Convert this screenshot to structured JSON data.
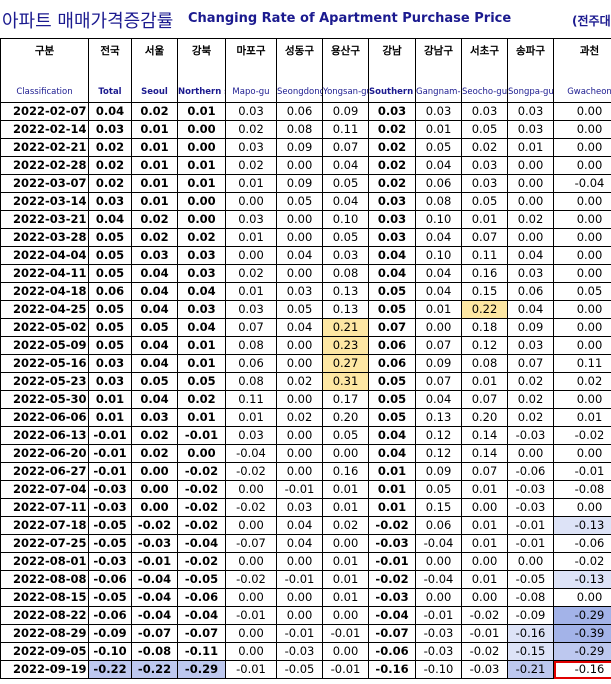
{
  "title": {
    "korean": "아파트 매매가격증감률",
    "english": "Changing Rate of Apartment Purchase Price",
    "unit": "(전주대비"
  },
  "columns": [
    {
      "kor": "구분",
      "eng": "Classification"
    },
    {
      "kor": "전국",
      "eng": "Total"
    },
    {
      "kor": "서울",
      "eng": "Seoul"
    },
    {
      "kor": "강북",
      "eng": "Northern seoul"
    },
    {
      "kor": "마포구",
      "eng": "Mapo-gu"
    },
    {
      "kor": "성동구",
      "eng": "Seongdong-gu"
    },
    {
      "kor": "용산구",
      "eng": "Yongsan-gu"
    },
    {
      "kor": "강남",
      "eng": "Southern Seoul"
    },
    {
      "kor": "강남구",
      "eng": "Gangnam-gu"
    },
    {
      "kor": "서초구",
      "eng": "Seocho-gu"
    },
    {
      "kor": "송파구",
      "eng": "Songpa-gu"
    },
    {
      "kor": "과천",
      "eng": "Gwacheon"
    }
  ],
  "rows": [
    {
      "date": "2022-02-07",
      "values": [
        "0.04",
        "0.02",
        "0.01",
        "0.03",
        "0.06",
        "0.09",
        "0.03",
        "0.03",
        "0.03",
        "0.03",
        "0.00"
      ]
    },
    {
      "date": "2022-02-14",
      "values": [
        "0.03",
        "0.01",
        "0.00",
        "0.02",
        "0.08",
        "0.11",
        "0.02",
        "0.01",
        "0.05",
        "0.03",
        "0.00"
      ]
    },
    {
      "date": "2022-02-21",
      "values": [
        "0.02",
        "0.01",
        "0.00",
        "0.03",
        "0.09",
        "0.07",
        "0.02",
        "0.05",
        "0.02",
        "0.01",
        "0.00"
      ]
    },
    {
      "date": "2022-02-28",
      "values": [
        "0.02",
        "0.01",
        "0.01",
        "0.02",
        "0.00",
        "0.04",
        "0.02",
        "0.04",
        "0.03",
        "0.00",
        "0.00"
      ]
    },
    {
      "date": "2022-03-07",
      "values": [
        "0.02",
        "0.01",
        "0.01",
        "0.01",
        "0.09",
        "0.05",
        "0.02",
        "0.06",
        "0.03",
        "0.00",
        "-0.04"
      ]
    },
    {
      "date": "2022-03-14",
      "values": [
        "0.03",
        "0.01",
        "0.00",
        "0.00",
        "0.05",
        "0.04",
        "0.03",
        "0.08",
        "0.05",
        "0.00",
        "0.00"
      ]
    },
    {
      "date": "2022-03-21",
      "values": [
        "0.04",
        "0.02",
        "0.00",
        "0.03",
        "0.00",
        "0.10",
        "0.03",
        "0.10",
        "0.01",
        "0.02",
        "0.00"
      ]
    },
    {
      "date": "2022-03-28",
      "values": [
        "0.05",
        "0.02",
        "0.02",
        "0.01",
        "0.00",
        "0.05",
        "0.03",
        "0.04",
        "0.07",
        "0.00",
        "0.00"
      ]
    },
    {
      "date": "2022-04-04",
      "values": [
        "0.05",
        "0.03",
        "0.03",
        "0.00",
        "0.04",
        "0.03",
        "0.04",
        "0.10",
        "0.11",
        "0.04",
        "0.00"
      ]
    },
    {
      "date": "2022-04-11",
      "values": [
        "0.05",
        "0.04",
        "0.03",
        "0.02",
        "0.00",
        "0.08",
        "0.04",
        "0.04",
        "0.16",
        "0.03",
        "0.00"
      ]
    },
    {
      "date": "2022-04-18",
      "values": [
        "0.06",
        "0.04",
        "0.04",
        "0.01",
        "0.03",
        "0.13",
        "0.05",
        "0.04",
        "0.15",
        "0.06",
        "0.05"
      ]
    },
    {
      "date": "2022-04-25",
      "values": [
        "0.05",
        "0.04",
        "0.03",
        "0.03",
        "0.05",
        "0.13",
        "0.05",
        "0.01",
        "0.22",
        "0.04",
        "0.00"
      ]
    },
    {
      "date": "2022-05-02",
      "values": [
        "0.05",
        "0.05",
        "0.04",
        "0.07",
        "0.04",
        "0.21",
        "0.07",
        "0.00",
        "0.18",
        "0.09",
        "0.00"
      ]
    },
    {
      "date": "2022-05-09",
      "values": [
        "0.05",
        "0.04",
        "0.01",
        "0.08",
        "0.00",
        "0.23",
        "0.06",
        "0.07",
        "0.12",
        "0.03",
        "0.00"
      ]
    },
    {
      "date": "2022-05-16",
      "values": [
        "0.03",
        "0.04",
        "0.01",
        "0.06",
        "0.00",
        "0.27",
        "0.06",
        "0.09",
        "0.08",
        "0.07",
        "0.11"
      ]
    },
    {
      "date": "2022-05-23",
      "values": [
        "0.03",
        "0.05",
        "0.05",
        "0.08",
        "0.02",
        "0.31",
        "0.05",
        "0.07",
        "0.01",
        "0.02",
        "0.02"
      ]
    },
    {
      "date": "2022-05-30",
      "values": [
        "0.01",
        "0.04",
        "0.02",
        "0.11",
        "0.00",
        "0.17",
        "0.05",
        "0.04",
        "0.07",
        "0.02",
        "0.00"
      ]
    },
    {
      "date": "2022-06-06",
      "values": [
        "0.01",
        "0.03",
        "0.01",
        "0.01",
        "0.02",
        "0.20",
        "0.05",
        "0.13",
        "0.20",
        "0.02",
        "0.01"
      ]
    },
    {
      "date": "2022-06-13",
      "values": [
        "-0.01",
        "0.02",
        "-0.01",
        "0.03",
        "0.00",
        "0.05",
        "0.04",
        "0.12",
        "0.14",
        "-0.03",
        "-0.02"
      ]
    },
    {
      "date": "2022-06-20",
      "values": [
        "-0.01",
        "0.02",
        "0.00",
        "-0.04",
        "0.00",
        "0.00",
        "0.04",
        "0.12",
        "0.14",
        "0.00",
        "0.00"
      ]
    },
    {
      "date": "2022-06-27",
      "values": [
        "-0.01",
        "0.00",
        "-0.02",
        "-0.02",
        "0.00",
        "0.16",
        "0.01",
        "0.09",
        "0.07",
        "-0.06",
        "-0.01"
      ]
    },
    {
      "date": "2022-07-04",
      "values": [
        "-0.03",
        "0.00",
        "-0.02",
        "0.00",
        "-0.01",
        "0.01",
        "0.01",
        "0.05",
        "0.01",
        "-0.03",
        "-0.08"
      ]
    },
    {
      "date": "2022-07-11",
      "values": [
        "-0.03",
        "0.00",
        "-0.02",
        "-0.02",
        "0.03",
        "0.01",
        "0.01",
        "0.15",
        "0.00",
        "-0.03",
        "0.00"
      ]
    },
    {
      "date": "2022-07-18",
      "values": [
        "-0.05",
        "-0.02",
        "-0.02",
        "0.00",
        "0.04",
        "0.02",
        "-0.02",
        "0.06",
        "0.01",
        "-0.01",
        "-0.13"
      ]
    },
    {
      "date": "2022-07-25",
      "values": [
        "-0.05",
        "-0.03",
        "-0.04",
        "-0.07",
        "0.04",
        "0.00",
        "-0.03",
        "-0.04",
        "0.01",
        "-0.01",
        "-0.06"
      ]
    },
    {
      "date": "2022-08-01",
      "values": [
        "-0.03",
        "-0.01",
        "-0.02",
        "0.00",
        "0.00",
        "0.01",
        "-0.01",
        "0.00",
        "0.00",
        "0.00",
        "-0.02"
      ]
    },
    {
      "date": "2022-08-08",
      "values": [
        "-0.06",
        "-0.04",
        "-0.05",
        "-0.02",
        "-0.01",
        "0.01",
        "-0.02",
        "-0.04",
        "0.01",
        "-0.05",
        "-0.13"
      ]
    },
    {
      "date": "2022-08-15",
      "values": [
        "-0.05",
        "-0.04",
        "-0.06",
        "0.00",
        "0.00",
        "0.01",
        "-0.03",
        "0.00",
        "0.00",
        "-0.08",
        "0.00"
      ]
    },
    {
      "date": "2022-08-22",
      "values": [
        "-0.06",
        "-0.04",
        "-0.04",
        "-0.01",
        "0.00",
        "0.00",
        "-0.04",
        "-0.01",
        "-0.02",
        "-0.09",
        "-0.29"
      ]
    },
    {
      "date": "2022-08-29",
      "values": [
        "-0.09",
        "-0.07",
        "-0.07",
        "0.00",
        "-0.01",
        "-0.01",
        "-0.07",
        "-0.03",
        "-0.01",
        "-0.16",
        "-0.39"
      ]
    },
    {
      "date": "2022-09-05",
      "values": [
        "-0.10",
        "-0.08",
        "-0.11",
        "0.00",
        "-0.03",
        "0.00",
        "-0.06",
        "-0.03",
        "-0.02",
        "-0.15",
        "-0.29"
      ]
    },
    {
      "date": "2022-09-19",
      "values": [
        "-0.22",
        "-0.22",
        "-0.29",
        "-0.01",
        "-0.05",
        "-0.01",
        "-0.16",
        "-0.10",
        "-0.03",
        "-0.21",
        "-0.16"
      ]
    }
  ],
  "highlight_colors": {
    "yellow": "#fde7a3",
    "blue_light": "#dde3f7",
    "blue_mid": "#bdc8ef",
    "blue_dark": "#a3b3e8",
    "selection_border": "#e00000",
    "header_text": "#1b1a8f"
  }
}
